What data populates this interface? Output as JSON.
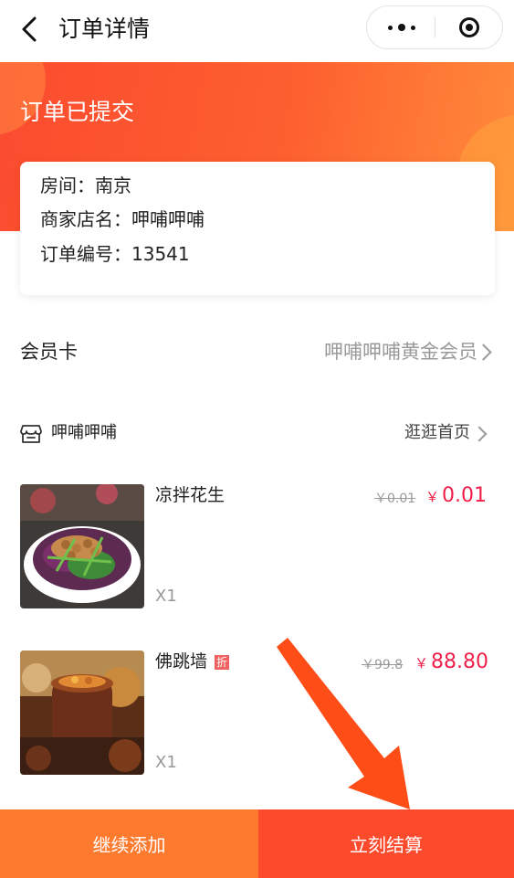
{
  "nav": {
    "title": "订单详情",
    "back_icon": "chevron-left-icon",
    "more_icon": "more-dots-icon",
    "close_icon": "target-circle-icon"
  },
  "status": {
    "title": "订单已提交"
  },
  "info": {
    "room": "房间：南京",
    "merchant": "商家店名：呷哺呷哺",
    "order_no": "订单编号：13541"
  },
  "member": {
    "label": "会员卡",
    "value": "呷哺呷哺黄金会员"
  },
  "shop": {
    "name": "呷哺呷哺",
    "link": "逛逛首页"
  },
  "products": [
    {
      "name": "凉拌花生",
      "qty": "X1",
      "old_price": "￥0.01",
      "currency": "￥",
      "price": "0.01",
      "tag": ""
    },
    {
      "name": "佛跳墙",
      "qty": "X1",
      "old_price": "￥99.8",
      "currency": "￥",
      "price": "88.80",
      "tag": "折"
    }
  ],
  "bottom": {
    "continue_label": "继续添加",
    "checkout_label": "立刻结算"
  },
  "colors": {
    "accent_orange": "#fd5f2f",
    "price_red": "#f0204a",
    "continue_bg": "#fd7a2f",
    "checkout_bg": "#fc4a2c"
  }
}
